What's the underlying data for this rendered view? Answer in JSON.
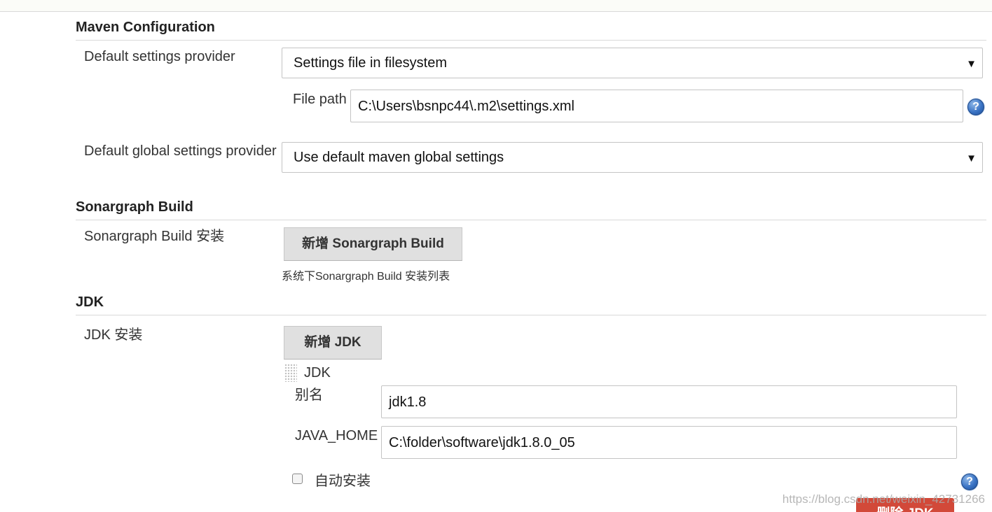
{
  "maven": {
    "title": "Maven Configuration",
    "default_settings_label": "Default settings provider",
    "default_settings_value": "Settings file in filesystem",
    "file_path_label": "File path",
    "file_path_value": "C:\\Users\\bsnpc44\\.m2\\settings.xml",
    "global_settings_label": "Default global settings provider",
    "global_settings_value": "Use default maven global settings"
  },
  "sonargraph": {
    "title": "Sonargraph Build",
    "install_label": "Sonargraph Build 安装",
    "add_button": "新增 Sonargraph Build",
    "description": "系统下Sonargraph Build 安装列表"
  },
  "jdk": {
    "title": "JDK",
    "install_label": "JDK 安装",
    "add_button": "新增 JDK",
    "item_header": "JDK",
    "alias_label": "别名",
    "alias_value": "jdk1.8",
    "java_home_label": "JAVA_HOME",
    "java_home_value": "C:\\folder\\software\\jdk1.8.0_05",
    "auto_install_label": "自动安装",
    "auto_install_checked": false,
    "delete_button": "删除 JDK"
  },
  "icons": {
    "dropdown": "triangle-down-icon",
    "help": "question-mark-help-icon",
    "drag": "drag-handle-icon"
  },
  "watermark": "https://blog.csdn.net/weixin_42731266"
}
